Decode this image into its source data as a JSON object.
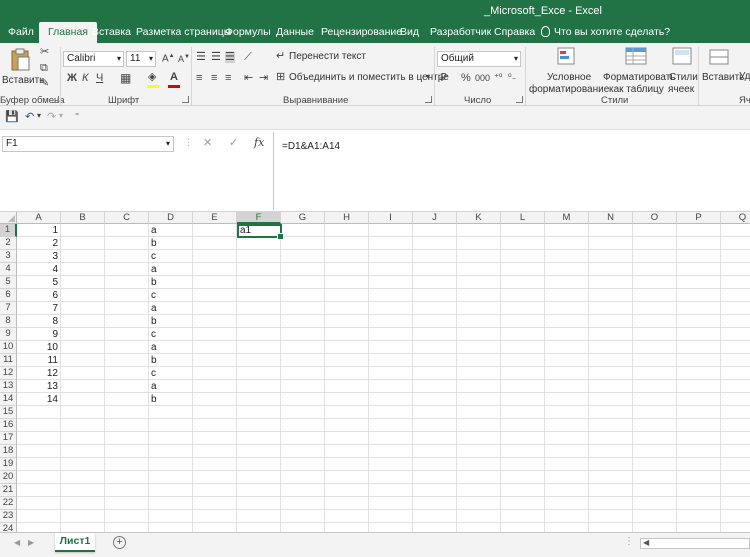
{
  "window": {
    "title": "_Microsoft_Exce  -  Excel"
  },
  "tabs": {
    "file": "Файл",
    "home": "Главная",
    "insert": "Вставка",
    "layout": "Разметка страницы",
    "formulas": "Формулы",
    "data": "Данные",
    "review": "Рецензирование",
    "view": "Вид",
    "developer": "Разработчик",
    "help": "Справка",
    "tellme": "Что вы хотите сделать?"
  },
  "ribbon": {
    "paste_label": "Вставить",
    "clipboard_label": "Буфер обмена",
    "font_name": "Calibri",
    "font_size": "11",
    "font_label": "Шрифт",
    "bold": "Ж",
    "italic": "К",
    "underline": "Ч",
    "wrap_text": "Перенести текст",
    "merge_center": "Объединить и поместить в центре",
    "alignment_label": "Выравнивание",
    "number_format": "Общий",
    "percent": "%",
    "thousands": "000",
    "number_label": "Число",
    "cond_format_1": "Условное",
    "cond_format_2": "форматирование",
    "format_table_1": "Форматировать",
    "format_table_2": "как таблицу",
    "cell_styles_1": "Стили",
    "cell_styles_2": "ячеек",
    "styles_label": "Стили",
    "insert_cells": "Вставить",
    "delete_cells": "Уд",
    "cells_label": "Яче"
  },
  "formula_bar": {
    "name_box": "F1",
    "formula": "=D1&A1:A14"
  },
  "sheet": {
    "columns": [
      "A",
      "B",
      "C",
      "D",
      "E",
      "F",
      "G",
      "H",
      "I",
      "J",
      "K",
      "L",
      "M",
      "N",
      "O",
      "P",
      "Q"
    ],
    "selected_column": "F",
    "rows": [
      "1",
      "2",
      "3",
      "4",
      "5",
      "6",
      "7",
      "8",
      "9",
      "10",
      "11",
      "12",
      "13",
      "14",
      "15",
      "16",
      "17",
      "18",
      "19",
      "20",
      "21",
      "22",
      "23",
      "24"
    ],
    "selected_row": "1",
    "col_a": [
      "1",
      "2",
      "3",
      "4",
      "5",
      "6",
      "7",
      "8",
      "9",
      "10",
      "11",
      "12",
      "13",
      "14"
    ],
    "col_d": [
      "a",
      "b",
      "c",
      "a",
      "b",
      "c",
      "a",
      "b",
      "c",
      "a",
      "b",
      "c",
      "a",
      "b"
    ],
    "active_value": "a1"
  },
  "sheet_tabs": {
    "active": "Лист1",
    "add": "+"
  },
  "colors": {
    "accent": "#217346"
  }
}
